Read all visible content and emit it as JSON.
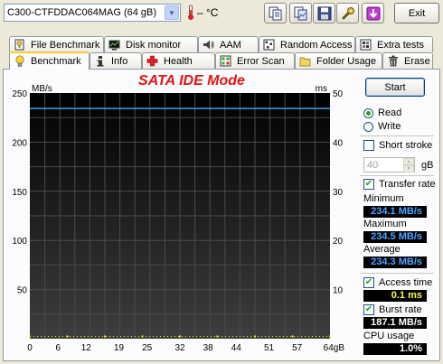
{
  "toolbar": {
    "drive": "C300-CTFDDAC064MAG (64 gB)",
    "temperature": "– °C",
    "buttons": [
      {
        "name": "copy-text-button",
        "icon": "copy-text-icon"
      },
      {
        "name": "copy-image-button",
        "icon": "copy-image-icon"
      },
      {
        "name": "save-button",
        "icon": "floppy-disk-icon"
      },
      {
        "name": "options-button",
        "icon": "wrench-icon"
      },
      {
        "name": "download-button",
        "icon": "download-arrow-icon"
      }
    ],
    "exit_label": "Exit"
  },
  "tabs_top": [
    {
      "label": "File Benchmark",
      "icon": "file-benchmark-icon"
    },
    {
      "label": "Disk monitor",
      "icon": "disk-monitor-icon"
    },
    {
      "label": "AAM",
      "icon": "speaker-icon"
    },
    {
      "label": "Random Access",
      "icon": "random-access-icon"
    },
    {
      "label": "Extra tests",
      "icon": "extra-tests-icon"
    }
  ],
  "tabs_bottom": [
    {
      "label": "Benchmark",
      "icon": "benchmark-bulb-icon",
      "active": true
    },
    {
      "label": "Info",
      "icon": "info-icon"
    },
    {
      "label": "Health",
      "icon": "health-cross-icon"
    },
    {
      "label": "Error Scan",
      "icon": "error-scan-icon"
    },
    {
      "label": "Folder Usage",
      "icon": "folder-icon"
    },
    {
      "label": "Erase",
      "icon": "trash-icon"
    }
  ],
  "chart_data": {
    "type": "line",
    "title": "SATA IDE Mode",
    "ylabel_left": "MB/s",
    "ylabel_right": "ms",
    "xlabel": "gB",
    "ylim": [
      0,
      250
    ],
    "ylim_right": [
      0,
      50
    ],
    "xlim": [
      0,
      64
    ],
    "y_ticks_left": [
      "250",
      "200",
      "150",
      "100",
      "50"
    ],
    "y_ticks_right": [
      "50",
      "40",
      "30",
      "20",
      "10"
    ],
    "x_ticks": [
      "0",
      "6",
      "12",
      "19",
      "25",
      "32",
      "38",
      "44",
      "51",
      "57",
      "64gB"
    ],
    "series": [
      {
        "name": "Transfer rate",
        "color": "#3d9fe6",
        "axis": "left",
        "x": [
          0,
          8,
          16,
          24,
          32,
          40,
          48,
          56,
          64
        ],
        "y": [
          234.3,
          234.3,
          234.3,
          234.3,
          234.3,
          234.3,
          234.3,
          234.3,
          234.3
        ]
      },
      {
        "name": "Access time",
        "color": "#e8e800",
        "axis": "right",
        "type": "scatter",
        "x": [
          0,
          8,
          16,
          24,
          32,
          40,
          48,
          56,
          64
        ],
        "y": [
          0.1,
          0.1,
          0.1,
          0.1,
          0.1,
          0.1,
          0.1,
          0.1,
          0.1
        ]
      }
    ]
  },
  "controls": {
    "start_label": "Start",
    "read_label": "Read",
    "write_label": "Write",
    "short_stroke_label": "Short stroke",
    "short_stroke_value": "40",
    "short_stroke_unit": "gB",
    "transfer_rate_label": "Transfer rate",
    "minimum_label": "Minimum",
    "minimum_value": "234.1 MB/s",
    "maximum_label": "Maximum",
    "maximum_value": "234.5 MB/s",
    "average_label": "Average",
    "average_value": "234.3 MB/s",
    "access_time_label": "Access time",
    "access_time_value": "0.1 ms",
    "burst_rate_label": "Burst rate",
    "burst_rate_value": "187.1 MB/s",
    "cpu_usage_label": "CPU usage",
    "cpu_usage_value": "1.0%"
  }
}
